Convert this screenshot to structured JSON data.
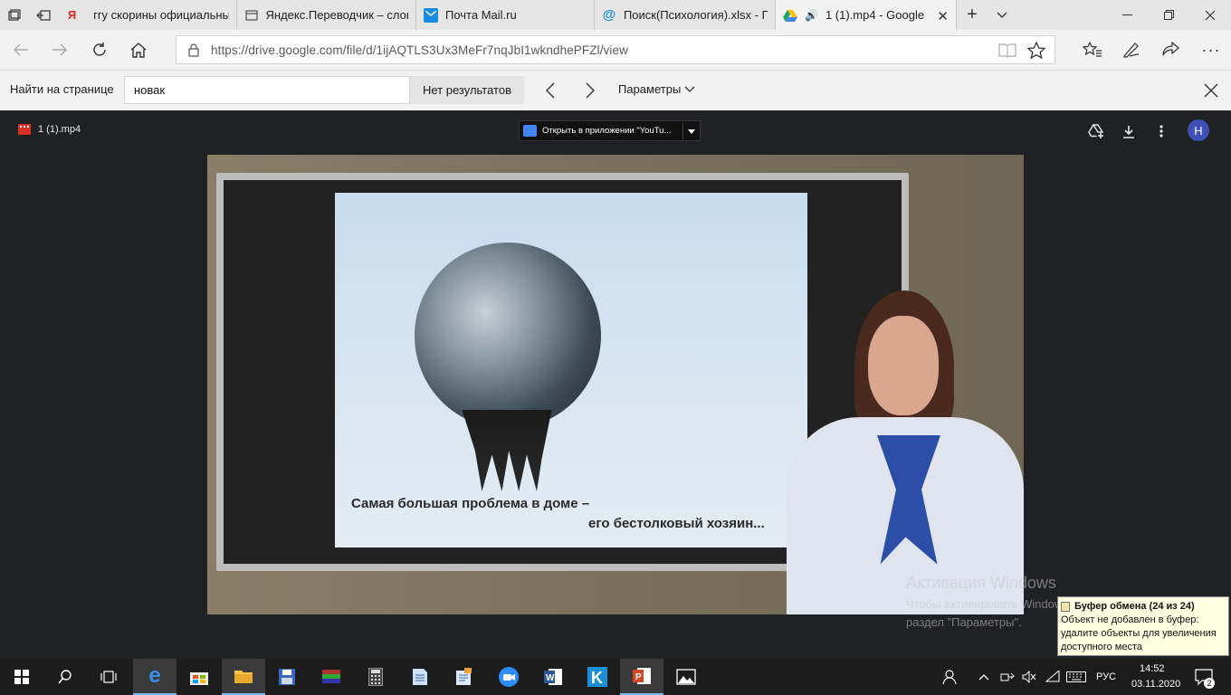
{
  "tabs": [
    {
      "label": "ггу скорины официальный",
      "favicon": "yandex-icon",
      "color": "#e52620"
    },
    {
      "label": "Яндекс.Переводчик – слов",
      "favicon": "page-icon",
      "color": "#333333"
    },
    {
      "label": "Почта Mail.ru",
      "favicon": "mail-icon",
      "color": "#168de2"
    },
    {
      "label": "Поиск(Психология).xlsx - Г",
      "favicon": "at-icon",
      "color": "#168de2"
    },
    {
      "label": "1 (1).mp4 - Google",
      "favicon": "drive-icon",
      "color": "#1fa463"
    }
  ],
  "address": {
    "url": "https://drive.google.com/file/d/1ijAQTLS3Ux3MeFr7nqJbI1wkndhePFZl/view"
  },
  "find": {
    "label": "Найти на странице",
    "query": "новак",
    "result": "Нет результатов",
    "params": "Параметры"
  },
  "viewer": {
    "filename": "1 (1).mp4",
    "open_with": "Открыть в приложении \"YouTu...",
    "avatar": "H"
  },
  "video": {
    "caption_line1": "Самая большая проблема в доме –",
    "caption_line2": "его бестолковый хозяин..."
  },
  "watermark": {
    "title": "Активация Windows",
    "line1": "Чтобы активировать Windows, перейдите в",
    "line2": "раздел \"Параметры\"."
  },
  "clipboard": {
    "title": "Буфер обмена (24 из 24)",
    "body": "Объект не добавлен в буфер: удалите объекты для увеличения доступного места"
  },
  "tray": {
    "lang": "РУС",
    "time": "14:52",
    "date": "03.11.2020",
    "notif_count": "2"
  }
}
